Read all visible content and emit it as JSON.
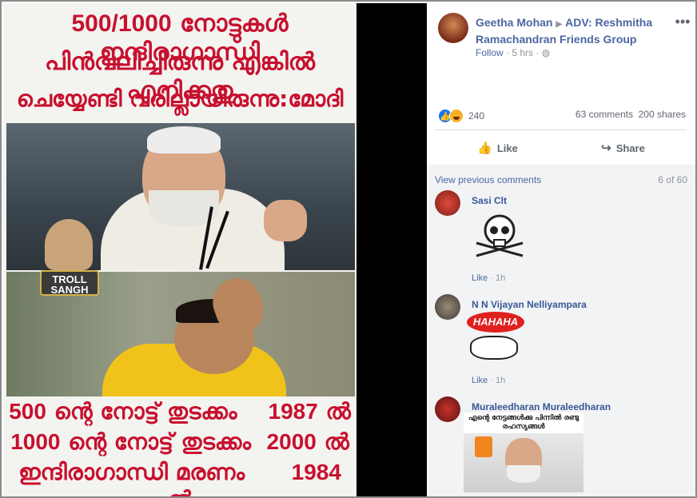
{
  "image_text": {
    "line1_num": "500/1000",
    "line1_ml": "നോട്ടുകൾ ഇന്ദിരാഗാന്ധി",
    "line2": "പിൻവലിച്ചിരുന്നു എങ്കിൽ എനിക്കതു",
    "line3": "ചെയ്യേണ്ടി വരില്ലായിരുന്നു:മോദി",
    "bottom": [
      {
        "left_num": "500",
        "left_ml": "ന്റെ നോട്ട് തുടക്കം",
        "right_num": "1987",
        "right_ml": "ൽ"
      },
      {
        "left_num": "1000",
        "left_ml": "ന്റെ നോട്ട് തുടക്കം",
        "right_num": "2000",
        "right_ml": "ൽ"
      },
      {
        "left_num": "",
        "left_ml": "ഇന്ദിരാഗാന്ധി മരണം",
        "right_num": "1984",
        "right_ml": "ൽ"
      }
    ],
    "logo_text": "TROLL SANGH"
  },
  "post": {
    "author": "Geetha Mohan",
    "group": "ADV: Reshmitha Ramachandran Friends Group",
    "follow_label": "Follow",
    "time": "5 hrs",
    "reaction_count": "240",
    "comments_count": "63 comments",
    "shares_count": "200 shares",
    "like_label": "Like",
    "share_label": "Share"
  },
  "comments_panel": {
    "view_previous": "View previous comments",
    "page_count": "6 of 60",
    "items": [
      {
        "name": "Sasi Clt",
        "like": "Like",
        "time": "1h"
      },
      {
        "name": "N N Vijayan Nelliyampara",
        "like": "Like",
        "time": "1h",
        "sticker_text": "HAHAHA"
      },
      {
        "name": "Muraleedharan Muraleedharan",
        "image_caption": "എന്റെ നേട്ടങ്ങൾക്കു പിന്നിൽ രണ്ടു രഹസ്യങ്ങൾ"
      }
    ]
  },
  "colors": {
    "malayalam_red": "#c8102e",
    "fb_link": "#4b67a1",
    "fb_blue": "#1877f2",
    "haha_yellow": "#f7b125"
  }
}
